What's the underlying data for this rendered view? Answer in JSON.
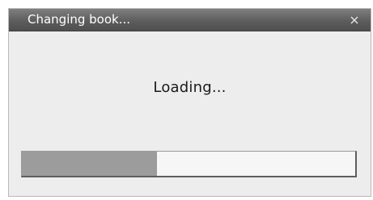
{
  "window": {
    "title": "Changing book...",
    "close_glyph": "×"
  },
  "dialog": {
    "message": "Loading..."
  },
  "progress": {
    "fraction": 0.405
  },
  "colors": {
    "titlebar": "#5d5d5d",
    "background": "#ededed",
    "progress_fill": "#9c9c9c"
  }
}
